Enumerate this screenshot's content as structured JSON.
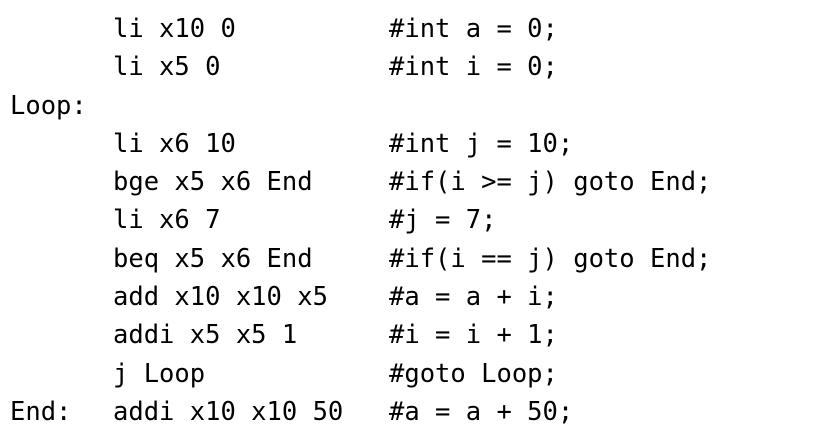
{
  "lines": [
    {
      "label": "",
      "instr": "li x10 0",
      "comment": "#int a = 0;"
    },
    {
      "label": "",
      "instr": "li x5 0",
      "comment": "#int i = 0;"
    },
    {
      "label": "Loop:",
      "instr": "",
      "comment": ""
    },
    {
      "label": "",
      "instr": "li x6 10",
      "comment": "#int j = 10;"
    },
    {
      "label": "",
      "instr": "bge x5 x6 End",
      "comment": "#if(i >= j) goto End;"
    },
    {
      "label": "",
      "instr": "li x6 7",
      "comment": "#j = 7;"
    },
    {
      "label": "",
      "instr": "beq x5 x6 End",
      "comment": "#if(i == j) goto End;"
    },
    {
      "label": "",
      "instr": "add x10 x10 x5",
      "comment": "#a = a + i;"
    },
    {
      "label": "",
      "instr": "addi x5 x5 1",
      "comment": "#i = i + 1;"
    },
    {
      "label": "",
      "instr": "j Loop",
      "comment": "#goto Loop;"
    },
    {
      "label": "End:",
      "instr": "addi x10 x10 50",
      "comment": "#a = a + 50;"
    }
  ]
}
